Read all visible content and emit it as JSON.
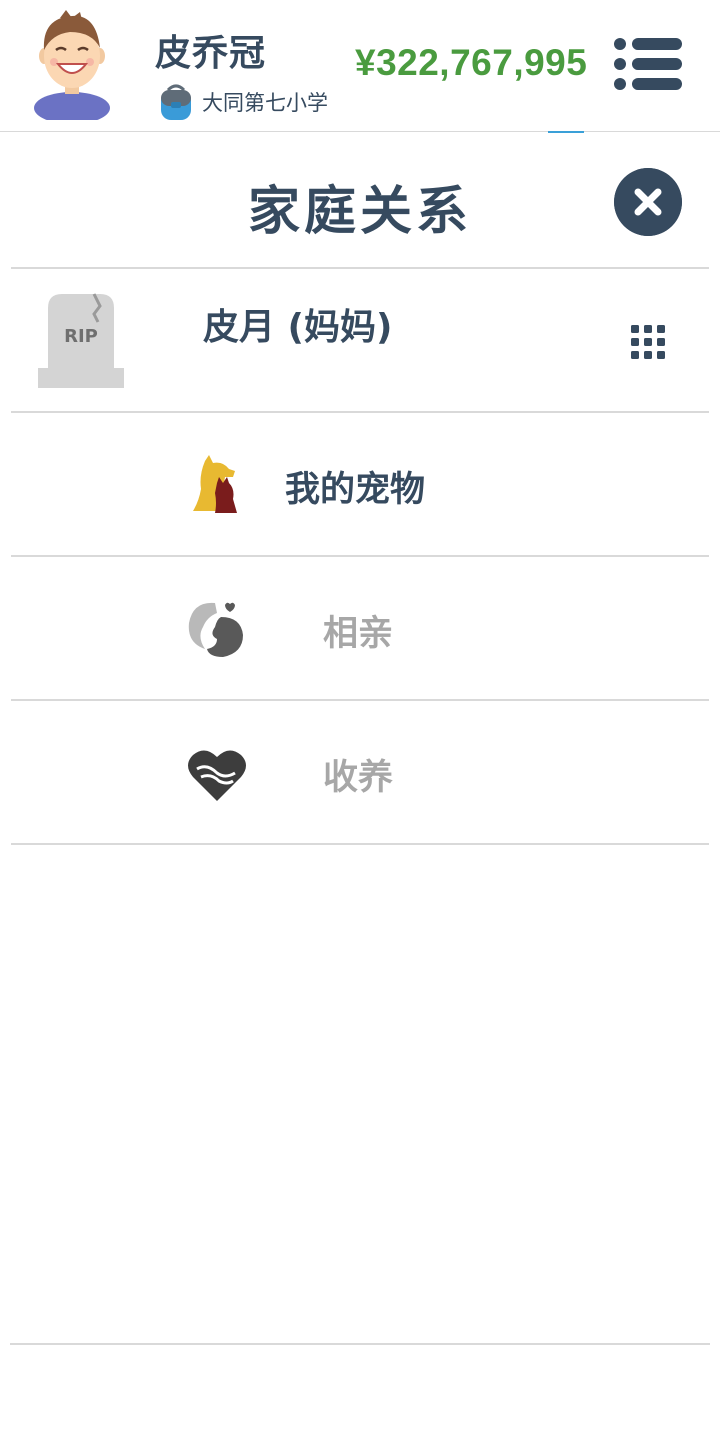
{
  "header": {
    "user_name": "皮乔冠",
    "school": "大同第七小学",
    "money": "¥322,767,995"
  },
  "title": {
    "text": "家庭关系"
  },
  "relatives": [
    {
      "name": "皮月 (妈妈)",
      "status": "RIP"
    }
  ],
  "menu": [
    {
      "label": "我的宠物",
      "enabled": true
    },
    {
      "label": "相亲",
      "enabled": false
    },
    {
      "label": "收养",
      "enabled": false
    }
  ],
  "colors": {
    "text_dark": "#364a5f",
    "money_green": "#4a9b3f",
    "disabled_gray": "#a7a7a7",
    "divider": "#d9d9d9"
  }
}
